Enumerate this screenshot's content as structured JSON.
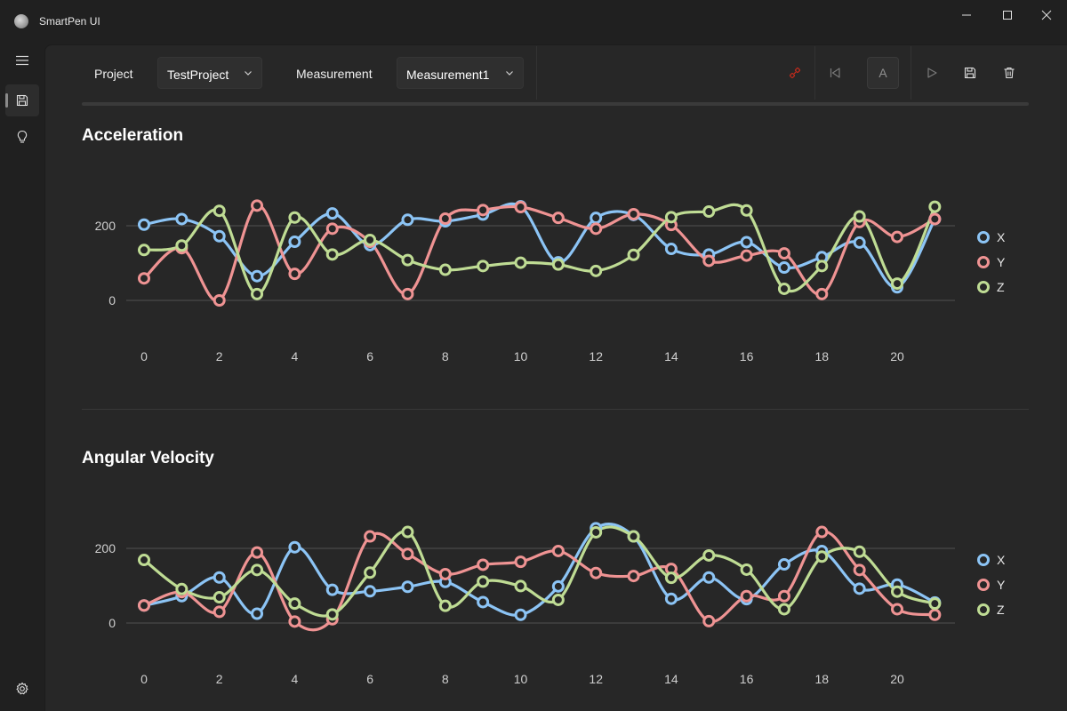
{
  "window": {
    "title": "SmartPen UI",
    "controls": [
      "minimize-icon",
      "maximize-icon",
      "close-icon"
    ]
  },
  "nav": {
    "items": [
      {
        "icon": "hamburger-menu-icon"
      },
      {
        "icon": "save-icon",
        "selected": true
      },
      {
        "icon": "lightbulb-icon"
      }
    ],
    "footer_icon": "settings-gear-icon"
  },
  "toolbar": {
    "project_label": "Project",
    "project_value": "TestProject",
    "measurement_label": "Measurement",
    "measurement_value": "Measurement1",
    "connect_icon": "disconnected-link-icon",
    "connect_icon_color": "#c42b1c",
    "skip_back_icon": "skip-to-start-icon",
    "auto_button_label": "A",
    "play_icon": "play-icon",
    "save_icon": "save-icon",
    "delete_icon": "trash-icon"
  },
  "colors": {
    "x": "#8cc4f5",
    "y": "#ef9393",
    "z": "#bfdc94",
    "background": "#272727"
  },
  "chart_data": [
    {
      "type": "line",
      "title": "Acceleration",
      "x": [
        0,
        1,
        2,
        3,
        4,
        5,
        6,
        7,
        8,
        9,
        10,
        11,
        12,
        13,
        14,
        15,
        16,
        17,
        18,
        19,
        20,
        21
      ],
      "xticks": [
        "0",
        "2",
        "4",
        "6",
        "8",
        "10",
        "12",
        "14",
        "16",
        "18",
        "20"
      ],
      "yticks": [
        "0",
        "200"
      ],
      "ylim": [
        0,
        300
      ],
      "legend": "right",
      "series": [
        {
          "name": "X",
          "values": [
            203,
            218,
            172,
            65,
            157,
            233,
            148,
            216,
            212,
            230,
            252,
            102,
            221,
            229,
            138,
            123,
            156,
            88,
            116,
            155,
            35,
            218
          ]
        },
        {
          "name": "Y",
          "values": [
            59,
            140,
            0,
            254,
            71,
            192,
            157,
            17,
            219,
            242,
            250,
            221,
            192,
            231,
            202,
            106,
            120,
            126,
            17,
            210,
            170,
            218
          ]
        },
        {
          "name": "Z",
          "values": [
            135,
            147,
            240,
            17,
            222,
            123,
            162,
            108,
            82,
            92,
            101,
            96,
            79,
            122,
            223,
            238,
            241,
            31,
            92,
            225,
            45,
            251
          ]
        }
      ]
    },
    {
      "type": "line",
      "title": "Angular Velocity",
      "x": [
        0,
        1,
        2,
        3,
        4,
        5,
        6,
        7,
        8,
        9,
        10,
        11,
        12,
        13,
        14,
        15,
        16,
        17,
        18,
        19,
        20,
        21
      ],
      "xticks": [
        "0",
        "2",
        "4",
        "6",
        "8",
        "10",
        "12",
        "14",
        "16",
        "18",
        "20"
      ],
      "yticks": [
        "0",
        "200"
      ],
      "ylim": [
        0,
        300
      ],
      "legend": "right",
      "series": [
        {
          "name": "X",
          "values": [
            47,
            72,
            122,
            25,
            203,
            89,
            85,
            97,
            110,
            56,
            22,
            98,
            254,
            232,
            65,
            122,
            64,
            157,
            193,
            92,
            103,
            55
          ]
        },
        {
          "name": "Y",
          "values": [
            47,
            83,
            30,
            189,
            4,
            10,
            232,
            185,
            131,
            156,
            164,
            193,
            134,
            126,
            145,
            5,
            72,
            72,
            244,
            142,
            37,
            22
          ]
        },
        {
          "name": "Z",
          "values": [
            169,
            91,
            69,
            142,
            52,
            23,
            135,
            244,
            46,
            111,
            99,
            62,
            243,
            232,
            121,
            181,
            143,
            37,
            178,
            191,
            84,
            52
          ]
        }
      ]
    }
  ]
}
